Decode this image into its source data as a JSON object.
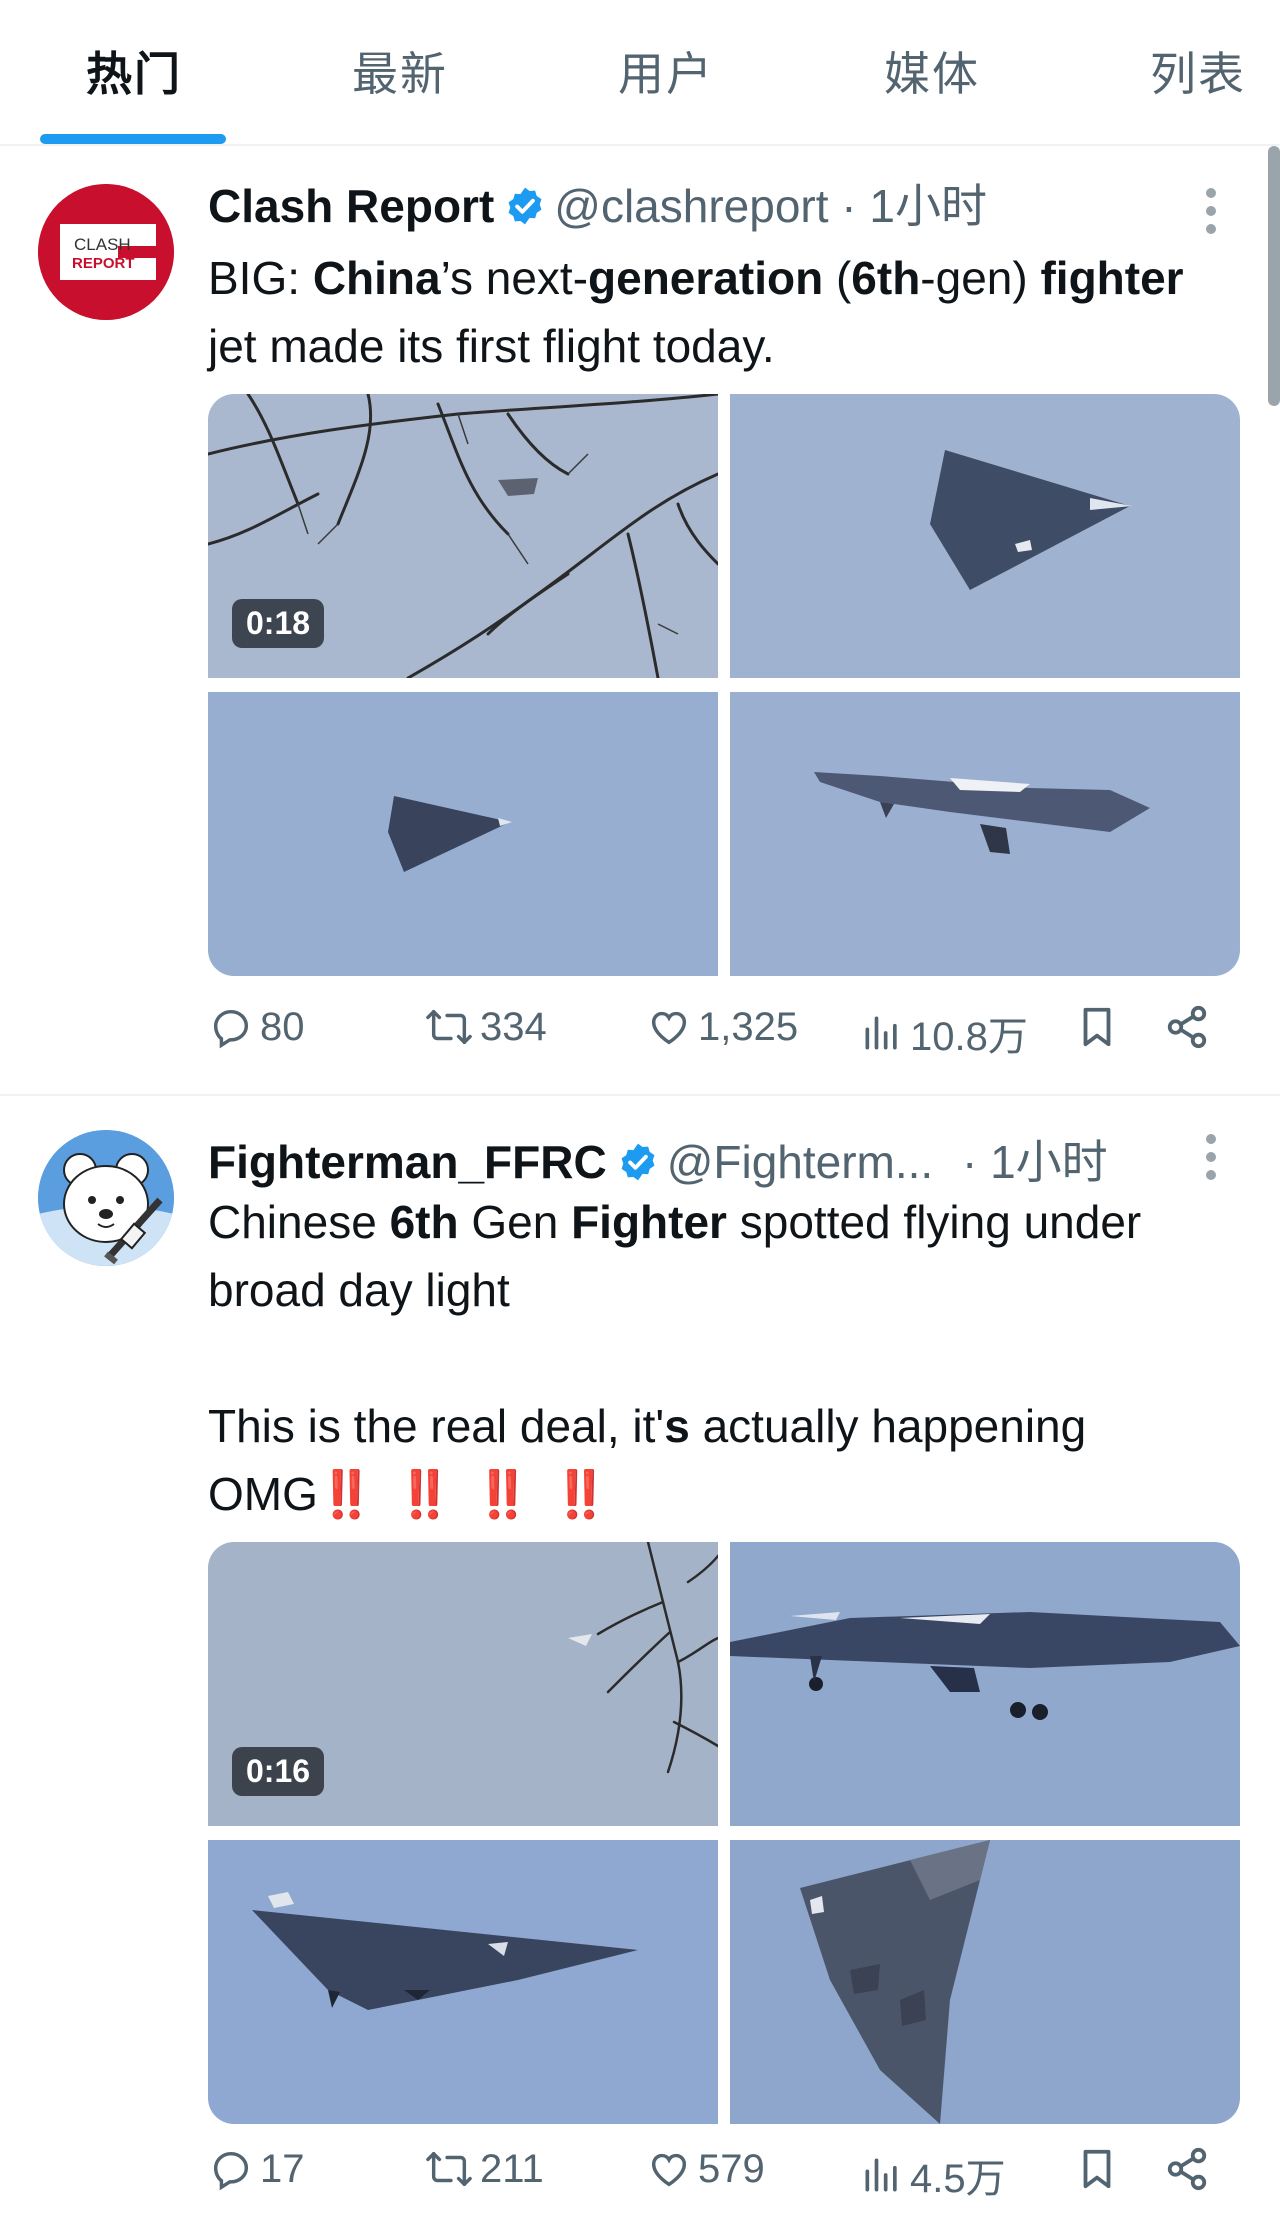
{
  "tabs": [
    {
      "label": "热门",
      "active": true
    },
    {
      "label": "最新",
      "active": false
    },
    {
      "label": "用户",
      "active": false
    },
    {
      "label": "媒体",
      "active": false
    },
    {
      "label": "列表",
      "active": false
    }
  ],
  "tweets": [
    {
      "display_name": "Clash Report",
      "handle": "@clashreport",
      "time": "· 1小时",
      "verified": true,
      "avatar_text": {
        "line1": "CLASH",
        "line2": "REPORT"
      },
      "text_segments": [
        {
          "t": "BIG: ",
          "bold": false
        },
        {
          "t": "China",
          "bold": true
        },
        {
          "t": "’s next-",
          "bold": false
        },
        {
          "t": "generation",
          "bold": true
        },
        {
          "t": " (",
          "bold": false
        },
        {
          "t": "6th",
          "bold": true
        },
        {
          "t": "-gen) ",
          "bold": false
        },
        {
          "t": "fighter",
          "bold": true
        },
        {
          "t": " jet made its first flight today.",
          "bold": false
        }
      ],
      "media_duration": "0:18",
      "stats": {
        "replies": "80",
        "retweets": "334",
        "likes": "1,325",
        "views": "10.8万"
      }
    },
    {
      "display_name": "Fighterman_FFRC",
      "handle": "@Fighterm...",
      "time": "· 1小时",
      "verified": true,
      "text_segments_p1": [
        {
          "t": "Chinese ",
          "bold": false
        },
        {
          "t": "6th",
          "bold": true
        },
        {
          "t": " Gen ",
          "bold": false
        },
        {
          "t": "Fighter",
          "bold": true
        },
        {
          "t": " spotted flying under broad day light",
          "bold": false
        }
      ],
      "text_segments_p2": [
        {
          "t": "This is the real deal, it'",
          "bold": false
        },
        {
          "t": "s",
          "bold": true
        },
        {
          "t": " actually happening OMG",
          "bold": false
        }
      ],
      "bangs": "‼️ ‼️ ‼️ ‼️",
      "media_duration": "0:16",
      "stats": {
        "replies": "17",
        "retweets": "211",
        "likes": "579",
        "views": "4.5万"
      }
    }
  ],
  "colors": {
    "accent": "#1d9bf0",
    "muted": "#536471",
    "avatar_red": "#c8102e"
  }
}
